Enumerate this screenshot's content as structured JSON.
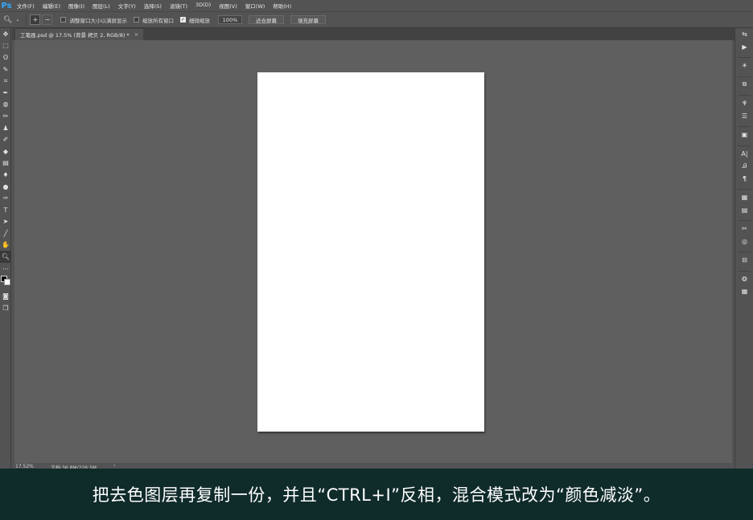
{
  "app": {
    "logo": "Ps"
  },
  "menubar": {
    "items": [
      "文件(F)",
      "编辑(E)",
      "图像(I)",
      "图层(L)",
      "文字(Y)",
      "选择(S)",
      "滤镜(T)",
      "3D(D)",
      "视图(V)",
      "窗口(W)",
      "帮助(H)"
    ]
  },
  "optionsbar": {
    "tool_icon": "zoom-icon",
    "zoom_in_symbol": "+",
    "zoom_out_symbol": "−",
    "resize_windows_label": "调整窗口大小以满屏显示",
    "resize_windows_checked": false,
    "zoom_all_windows_label": "缩放所有窗口",
    "zoom_all_windows_checked": false,
    "scrubby_zoom_label": "细微缩放",
    "scrubby_zoom_checked": true,
    "zoom_percent": "100%",
    "fit_screen_label": "适合屏幕",
    "fill_screen_label": "填充屏幕"
  },
  "document": {
    "tab_title": "工笔画.psd @ 17.5% (背景 拷贝 2, RGB/8) *",
    "close_symbol": "×",
    "status_zoom": "17.52%",
    "status_doc_size": "文档:36.8M/226.5M",
    "status_arrow": "›"
  },
  "toolbar": {
    "tools": [
      {
        "name": "move-tool",
        "glyph": "✥"
      },
      {
        "name": "marquee-tool",
        "glyph": "⬚"
      },
      {
        "name": "lasso-tool",
        "glyph": "ʘ"
      },
      {
        "name": "quick-selection-tool",
        "glyph": "✎"
      },
      {
        "name": "crop-tool",
        "glyph": "⌗"
      },
      {
        "name": "eyedropper-tool",
        "glyph": "✒"
      },
      {
        "name": "spot-healing-tool",
        "glyph": "◍"
      },
      {
        "name": "brush-tool",
        "glyph": "✏"
      },
      {
        "name": "clone-stamp-tool",
        "glyph": "♟"
      },
      {
        "name": "history-brush-tool",
        "glyph": "✐"
      },
      {
        "name": "eraser-tool",
        "glyph": "◆"
      },
      {
        "name": "gradient-tool",
        "glyph": "▤"
      },
      {
        "name": "blur-tool",
        "glyph": "♦"
      },
      {
        "name": "dodge-tool",
        "glyph": "●"
      },
      {
        "name": "pen-tool",
        "glyph": "✑"
      },
      {
        "name": "type-tool",
        "glyph": "T"
      },
      {
        "name": "path-selection-tool",
        "glyph": "➤"
      },
      {
        "name": "line-tool",
        "glyph": "╱"
      },
      {
        "name": "hand-tool",
        "glyph": "✋"
      },
      {
        "name": "zoom-tool",
        "glyph": "🔍︎"
      },
      {
        "name": "more-tools",
        "glyph": "⋯"
      }
    ],
    "after_colors": [
      {
        "name": "quick-mask-tool",
        "glyph": "◙"
      },
      {
        "name": "screen-mode-tool",
        "glyph": "❐"
      }
    ]
  },
  "panel_dock": {
    "icons": [
      {
        "name": "history-icon",
        "glyph": "⇆"
      },
      {
        "name": "actions-play-icon",
        "glyph": "▶"
      },
      {
        "name": "sep"
      },
      {
        "name": "adjustments-sun-icon",
        "glyph": "☀"
      },
      {
        "name": "sep"
      },
      {
        "name": "clone-source-icon",
        "glyph": "⧉"
      },
      {
        "name": "sep"
      },
      {
        "name": "brush-presets-icon",
        "glyph": "♆"
      },
      {
        "name": "brush-settings-icon",
        "glyph": "☰"
      },
      {
        "name": "sep"
      },
      {
        "name": "properties-icon",
        "glyph": "▣"
      },
      {
        "name": "sep"
      },
      {
        "name": "character-icon",
        "glyph": "A|"
      },
      {
        "name": "glyphs-icon",
        "glyph": "Ꭿ"
      },
      {
        "name": "paragraph-icon",
        "glyph": "¶"
      },
      {
        "name": "sep"
      },
      {
        "name": "libraries-icon",
        "glyph": "▦"
      },
      {
        "name": "notes-icon",
        "glyph": "▤"
      },
      {
        "name": "sep"
      },
      {
        "name": "tools-cross-icon",
        "glyph": "✂"
      },
      {
        "name": "styles-icon",
        "glyph": "◎"
      },
      {
        "name": "sep"
      },
      {
        "name": "layer-comps-icon",
        "glyph": "⊟"
      },
      {
        "name": "sep"
      },
      {
        "name": "3d-icon",
        "glyph": "❂"
      },
      {
        "name": "swatches-grid-icon",
        "glyph": "▦"
      }
    ]
  },
  "caption": {
    "text": "把去色图层再复制一份，并且“CTRL+I”反相，混合模式改为“颜色减淡”。"
  },
  "colors": {
    "ui_background": "#535353",
    "canvas_background": "#5f5f5f",
    "document": "#ffffff",
    "caption_background": "#0f2b2a",
    "caption_text": "#ffffff",
    "ps_logo": "#31a8ff"
  }
}
